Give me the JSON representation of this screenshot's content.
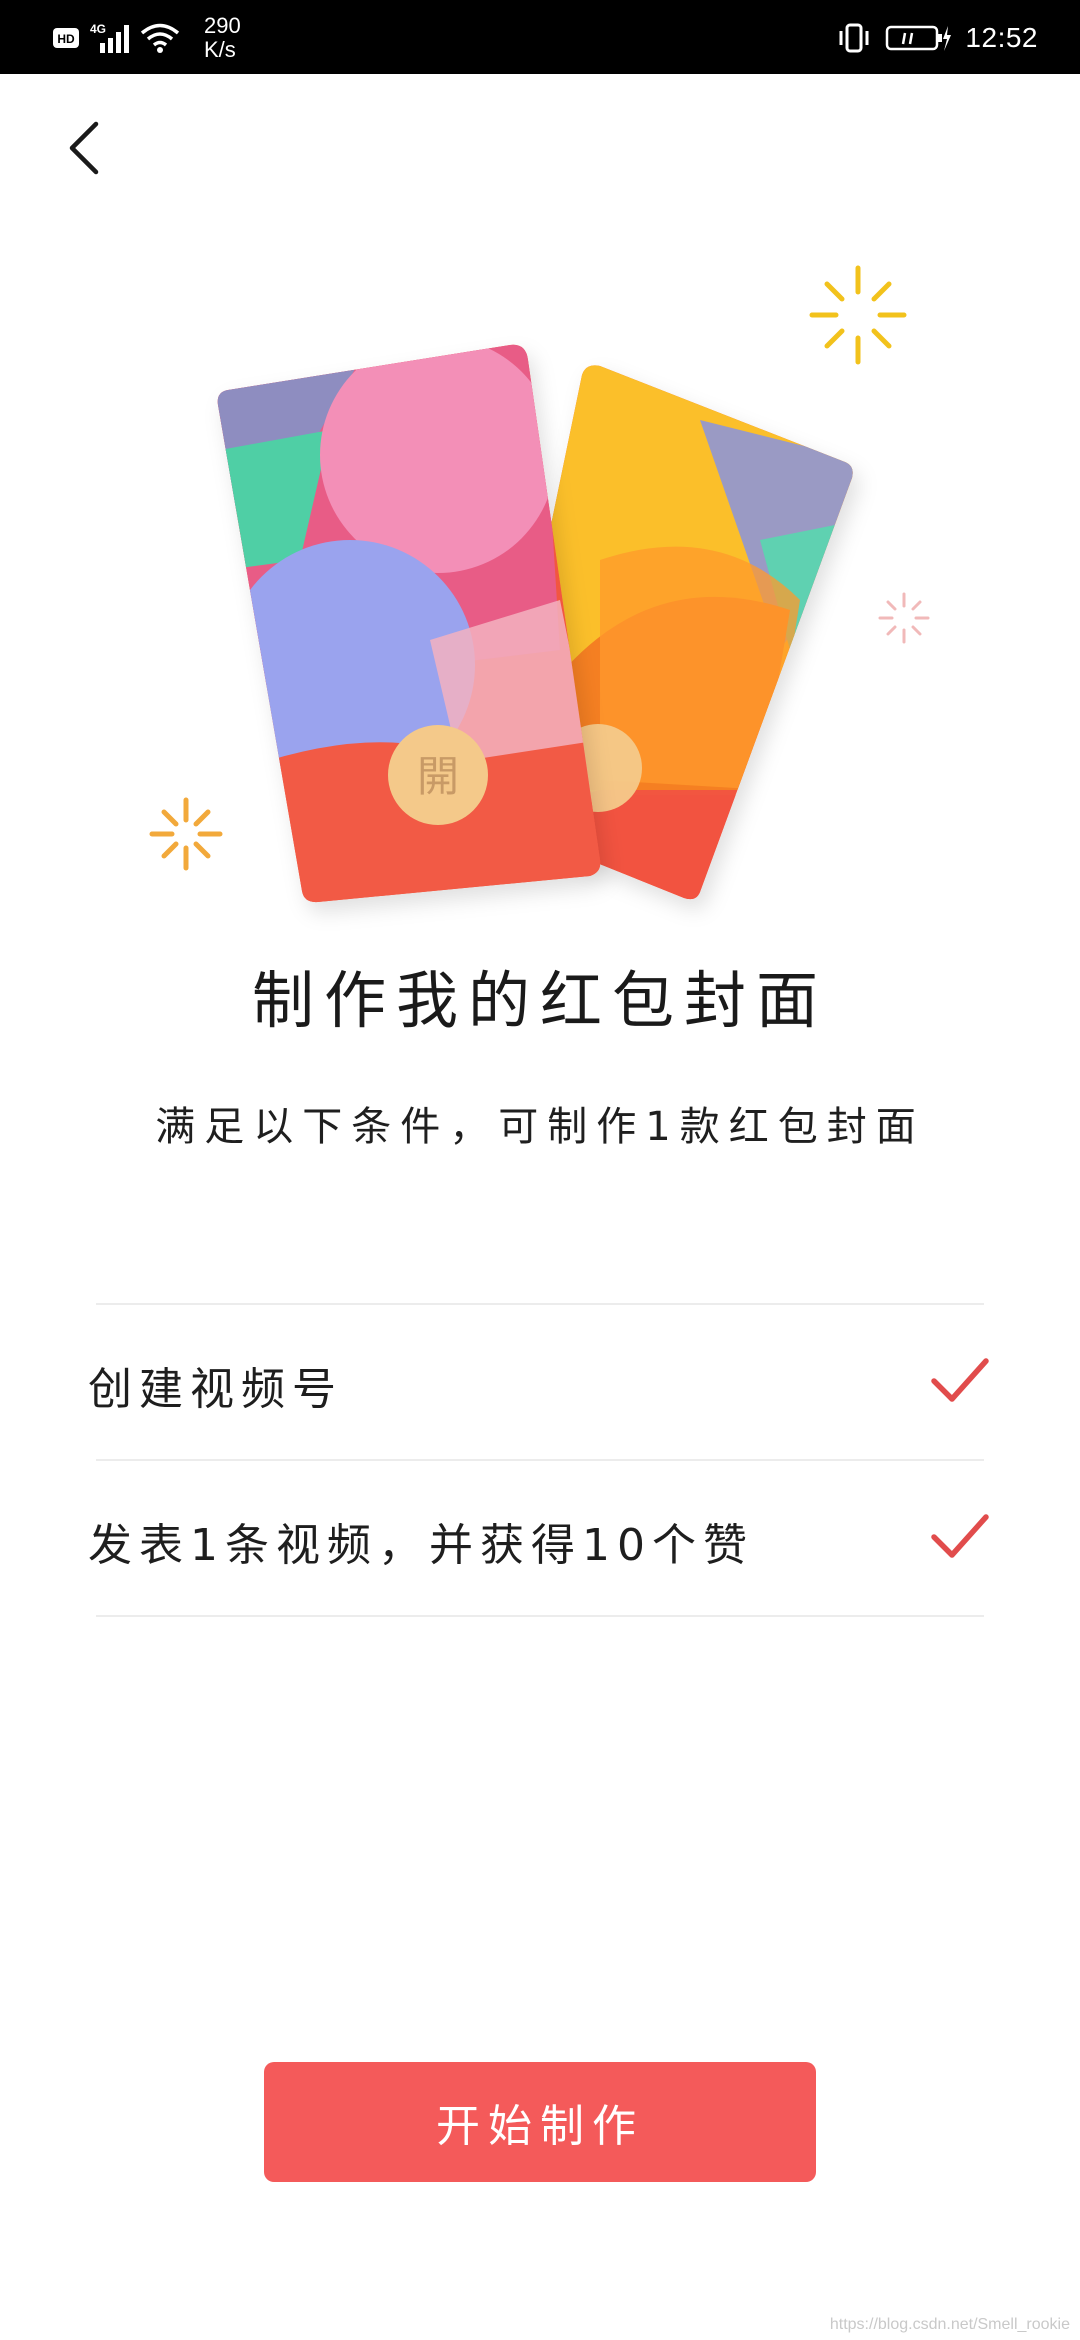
{
  "status_bar": {
    "hd_label": "HD",
    "network_label": "4G",
    "speed_value": "290",
    "speed_unit": "K/s",
    "time": "12:52"
  },
  "header": {
    "back_icon": "chevron-left-icon"
  },
  "main": {
    "title": "制作我的红包封面",
    "subtitle": "满足以下条件，可制作1款红包封面",
    "conditions": [
      {
        "label": "创建视频号",
        "met": true
      },
      {
        "label": "发表1条视频，并获得10个赞",
        "met": true
      }
    ],
    "card_stamp": "開",
    "start_button_label": "开始制作"
  },
  "watermark": "https://blog.csdn.net/Smell_rookie",
  "colors": {
    "accent": "#f45a5a",
    "check": "#e14c4c",
    "sparkle_yellow": "#f2c21c",
    "sparkle_orange": "#f2a93b",
    "sparkle_pink": "#f1b9b9"
  }
}
